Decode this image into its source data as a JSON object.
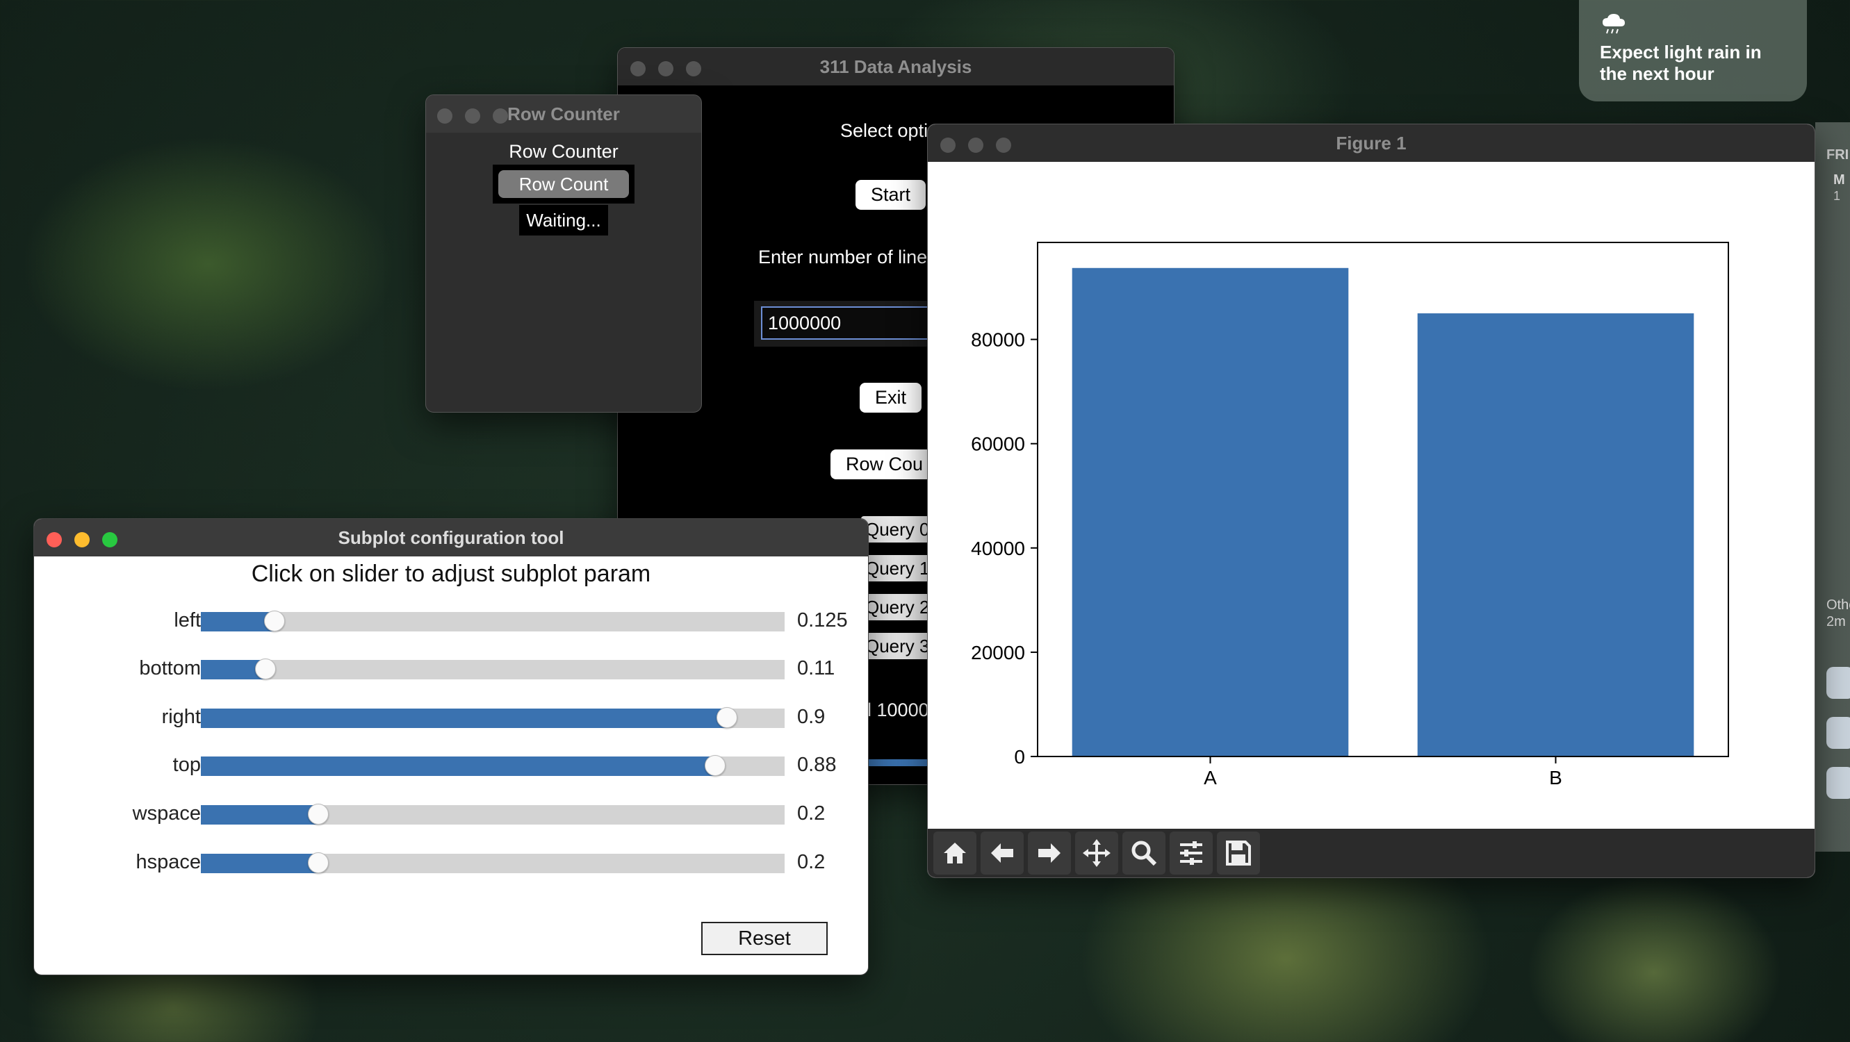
{
  "weather": {
    "icon": "cloud-rain-icon",
    "text": "Expect light rain in the next hour"
  },
  "side_widgets": {
    "label1": "FRI",
    "label2": "M",
    "label3": "1",
    "label4": "Othe",
    "label5": "2m"
  },
  "app311": {
    "title": "311 Data Analysis",
    "select_label": "Select opti",
    "start_button": "Start",
    "lines_label": "Enter number of line",
    "lines_value": "1000000",
    "exit_button": "Exit",
    "row_count_button": "Row Cou",
    "queries": [
      "Query 0",
      "Query 1",
      "Query 2",
      "Query 3"
    ],
    "status_text": "d 10000"
  },
  "row_counter": {
    "title": "Row Counter",
    "heading": "Row Counter",
    "button": "Row Count",
    "status": "Waiting..."
  },
  "figure": {
    "title": "Figure 1",
    "toolbar": [
      "home-icon",
      "back-icon",
      "forward-icon",
      "pan-icon",
      "zoom-icon",
      "configure-subplots-icon",
      "save-icon"
    ]
  },
  "chart_data": {
    "type": "bar",
    "categories": [
      "A",
      "B"
    ],
    "values": [
      93700,
      85000
    ],
    "title": "",
    "xlabel": "",
    "ylabel": "",
    "ylim": [
      0,
      98600
    ],
    "yticks": [
      0,
      20000,
      40000,
      60000,
      80000
    ],
    "bar_color": "#3a72b0",
    "grid": false
  },
  "subplot_tool": {
    "title": "Subplot configuration tool",
    "heading": "Click on slider to adjust subplot param",
    "sliders": [
      {
        "label": "left",
        "value": "0.125",
        "fill": 0.125
      },
      {
        "label": "bottom",
        "value": "0.11",
        "fill": 0.11
      },
      {
        "label": "right",
        "value": "0.9",
        "fill": 0.9
      },
      {
        "label": "top",
        "value": "0.88",
        "fill": 0.88
      },
      {
        "label": "wspace",
        "value": "0.2",
        "fill": 0.2
      },
      {
        "label": "hspace",
        "value": "0.2",
        "fill": 0.2
      }
    ],
    "reset_button": "Reset",
    "accent": "#3a72b0"
  }
}
